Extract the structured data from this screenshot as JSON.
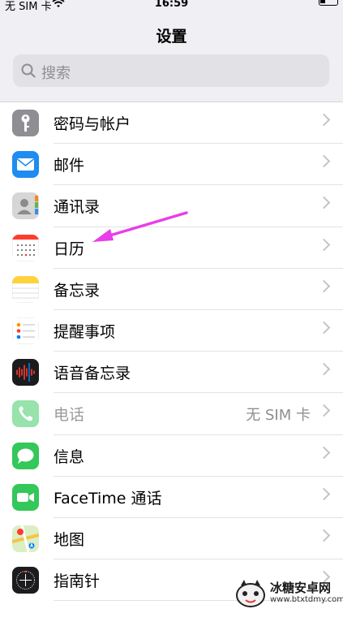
{
  "status_bar": {
    "carrier": "无 SIM 卡",
    "time": "16:59"
  },
  "title": "设置",
  "search": {
    "placeholder": "搜索"
  },
  "rows": [
    {
      "label": "密码与帐户",
      "icon": "key-icon",
      "color": "#8e8e93"
    },
    {
      "label": "邮件",
      "icon": "mail-icon",
      "color": "#1e8cf0"
    },
    {
      "label": "通讯录",
      "icon": "contacts-icon",
      "color": "#cfcfcf"
    },
    {
      "label": "日历",
      "icon": "calendar-icon",
      "color": "#ffffff"
    },
    {
      "label": "备忘录",
      "icon": "notes-icon",
      "color": "#ffd23c"
    },
    {
      "label": "提醒事项",
      "icon": "reminders-icon",
      "color": "#ffffff"
    },
    {
      "label": "语音备忘录",
      "icon": "voice-memos-icon",
      "color": "#1c1c1e"
    },
    {
      "label": "电话",
      "detail": "无 SIM 卡",
      "icon": "phone-icon",
      "color": "#34c759",
      "dimmed": true
    },
    {
      "label": "信息",
      "icon": "messages-icon",
      "color": "#34c759"
    },
    {
      "label": "FaceTime 通话",
      "icon": "facetime-icon",
      "color": "#34c759"
    },
    {
      "label": "地图",
      "icon": "maps-icon",
      "color": "#cfe8b0"
    },
    {
      "label": "指南针",
      "icon": "compass-icon",
      "color": "#1c1c1e"
    }
  ],
  "watermark": {
    "name": "冰糖安卓网",
    "url": "www.btxtdmy.com"
  },
  "annotation_color": "#e83ee8"
}
